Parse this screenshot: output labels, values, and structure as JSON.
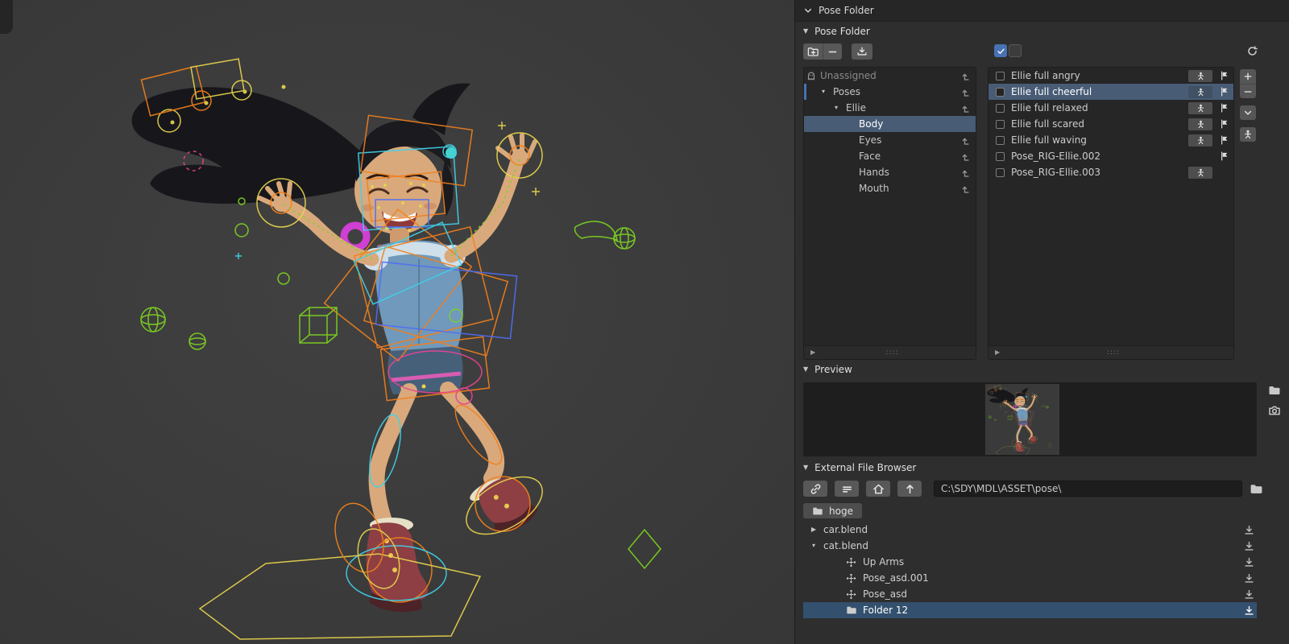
{
  "colors": {
    "accent": "#4772b3",
    "selection": "#485c76"
  },
  "icons": {
    "tri_down": "▼",
    "tri_right": "▶",
    "tri_down_s": "▾",
    "grip": "::::"
  },
  "top_header": {
    "title": "Pose Folder"
  },
  "pose_folder": {
    "title": "Pose Folder",
    "tree": {
      "items": [
        {
          "label": "Unassigned",
          "depth": 0,
          "disabled": true
        },
        {
          "label": "Poses",
          "depth": 0,
          "expanded": true,
          "active_marker": true
        },
        {
          "label": "Ellie",
          "depth": 1,
          "expanded": true
        },
        {
          "label": "Body",
          "depth": 2,
          "selected": true
        },
        {
          "label": "Eyes",
          "depth": 2
        },
        {
          "label": "Face",
          "depth": 2
        },
        {
          "label": "Hands",
          "depth": 2
        },
        {
          "label": "Mouth",
          "depth": 2
        }
      ]
    },
    "poses": {
      "items": [
        {
          "label": "Ellie full angry",
          "rig_button": true,
          "flag": true,
          "selected": false
        },
        {
          "label": "Ellie full cheerful",
          "rig_button": true,
          "flag": true,
          "selected": true
        },
        {
          "label": "Ellie full relaxed",
          "rig_button": true,
          "flag": true,
          "selected": false
        },
        {
          "label": "Ellie full scared",
          "rig_button": true,
          "flag": true,
          "selected": false
        },
        {
          "label": "Ellie full waving",
          "rig_button": true,
          "flag": true,
          "selected": false
        },
        {
          "label": "Pose_RIG-Ellie.002",
          "rig_button": false,
          "flag": true,
          "selected": false
        },
        {
          "label": "Pose_RIG-Ellie.003",
          "rig_button": true,
          "flag": false,
          "selected": false
        }
      ]
    }
  },
  "preview": {
    "title": "Preview"
  },
  "file_browser": {
    "title": "External File Browser",
    "path": "C:\\SDY\\MDL\\ASSET\\pose\\",
    "breadcrumb": "hoge",
    "rows": [
      {
        "label": "car.blend",
        "kind": "blend",
        "expanded": false,
        "selected": false
      },
      {
        "label": "cat.blend",
        "kind": "blend",
        "expanded": true,
        "selected": false
      },
      {
        "label": "Up Arms",
        "kind": "pose",
        "selected": false
      },
      {
        "label": "Pose_asd.001",
        "kind": "pose",
        "selected": false
      },
      {
        "label": "Pose_asd",
        "kind": "pose",
        "selected": false
      },
      {
        "label": "Folder 12",
        "kind": "folder",
        "selected": true
      }
    ]
  }
}
